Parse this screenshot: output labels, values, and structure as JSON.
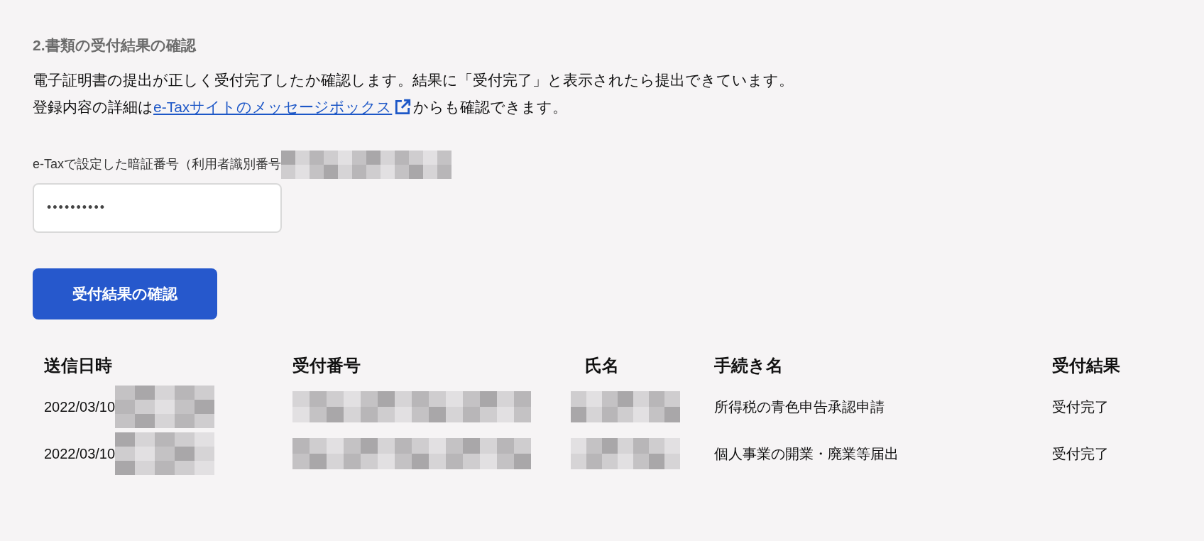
{
  "heading": "2.書類の受付結果の確認",
  "description": {
    "line1": "電子証明書の提出が正しく受付完了したか確認します。結果に「受付完了」と表示されたら提出できています。",
    "line2_before": "登録内容の詳細は",
    "link": "e-Taxサイトのメッセージボックス",
    "line2_after": "からも確認できます。"
  },
  "pin_field": {
    "label": "e-Taxで設定した暗証番号（利用者識別番号",
    "value": "••••••••••"
  },
  "check_button": "受付結果の確認",
  "table": {
    "columns": [
      "送信日時",
      "受付番号",
      "氏名",
      "手続き名",
      "受付結果"
    ],
    "rows": [
      {
        "sent_at": "2022/03/10",
        "procedure": "所得税の青色申告承認申請",
        "result": "受付完了"
      },
      {
        "sent_at": "2022/03/10",
        "procedure": "個人事業の開業・廃業等届出",
        "result": "受付完了"
      }
    ]
  }
}
